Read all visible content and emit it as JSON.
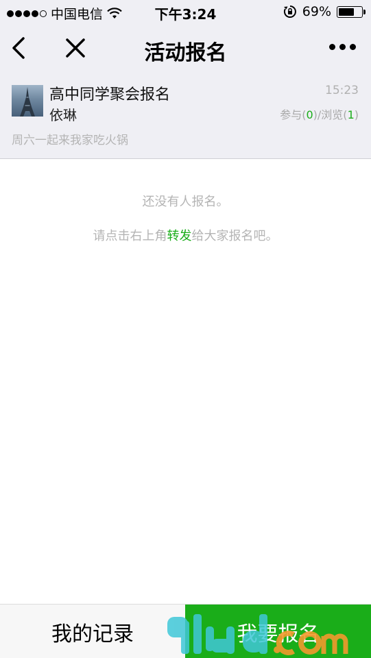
{
  "status_bar": {
    "carrier": "中国电信",
    "time": "下午3:24",
    "battery_pct": "69%",
    "battery_level": 0.69
  },
  "nav": {
    "title": "活动报名"
  },
  "activity": {
    "title": "高中同学聚会报名",
    "author": "依琳",
    "time": "15:23",
    "stats_join_label": "参与(",
    "stats_join_count": "0",
    "stats_view_label": ")/浏览(",
    "stats_view_count": "1",
    "stats_close": ")",
    "description": "周六一起来我家吃火锅"
  },
  "empty_state": {
    "message": "还没有人报名。",
    "hint_before": "请点击右上角",
    "hint_link": "转发",
    "hint_after": "给大家报名吧。"
  },
  "bottom": {
    "records_label": "我的记录",
    "signup_label": "我要报名"
  },
  "colors": {
    "accent": "#1aad19",
    "bar_bg": "#efeff4"
  },
  "icons": {
    "back": "chevron-left-icon",
    "close": "close-icon",
    "more": "more-icon",
    "wifi": "wifi-icon",
    "rotation_lock": "rotation-lock-icon",
    "battery": "battery-icon"
  }
}
